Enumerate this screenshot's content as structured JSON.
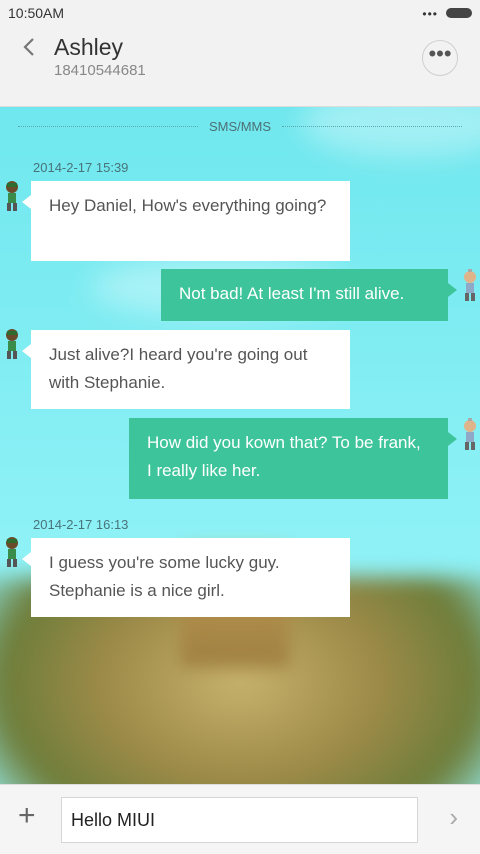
{
  "status_bar": {
    "time": "10:50AM",
    "signal_dots": "•••"
  },
  "header": {
    "back_icon": "chevron-left-icon",
    "contact_name": "Ashley",
    "contact_number": "18410544681",
    "more_label": "•••"
  },
  "chat": {
    "channel_label": "SMS/MMS",
    "timestamps": [
      "2014-2-17 15:39",
      "2014-2-17 16:13"
    ],
    "messages": [
      {
        "direction": "in",
        "text": "Hey Daniel, How's everything going?"
      },
      {
        "direction": "out",
        "text": "Not bad! At least I'm still alive."
      },
      {
        "direction": "in",
        "text": "Just  alive?I heard you're going out with Stephanie."
      },
      {
        "direction": "out",
        "text": "How did you kown that? To be frank, I really like her."
      },
      {
        "direction": "in",
        "text": "I guess you're some lucky guy. Stephanie is a nice girl."
      }
    ]
  },
  "composer": {
    "add_label": "+",
    "input_value": "Hello MIUI",
    "send_label": "›"
  },
  "colors": {
    "incoming_bubble": "#ffffff",
    "outgoing_bubble": "#3ec49a",
    "chat_background": "#7ff0f5"
  }
}
